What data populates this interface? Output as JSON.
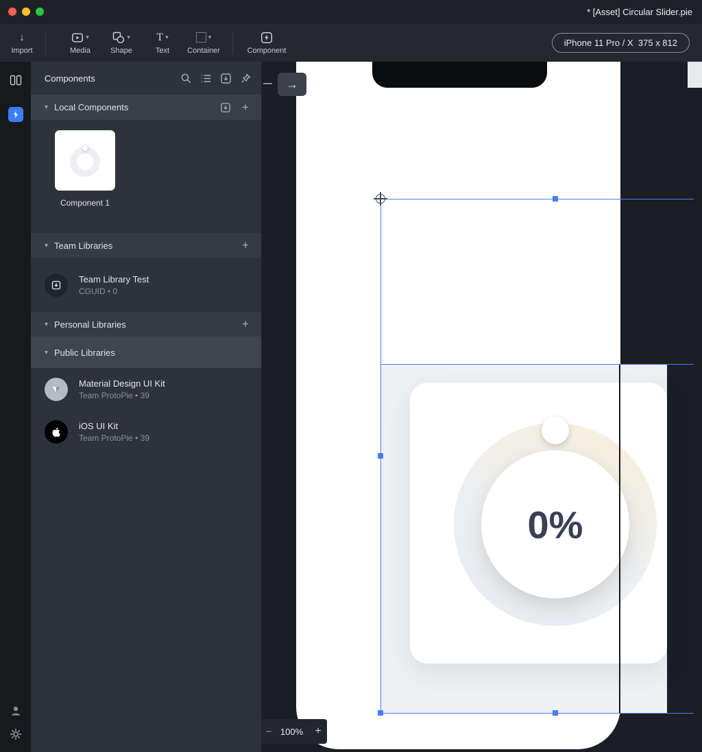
{
  "titlebar": {
    "title": "* [Asset] Circular Slider.pie"
  },
  "toolbar": {
    "import_label": "Import",
    "media_label": "Media",
    "shape_label": "Shape",
    "text_label": "Text",
    "container_label": "Container",
    "component_label": "Component",
    "device_label": "iPhone 11 Pro / X  375 x 812"
  },
  "sidebar": {
    "title": "Components",
    "local_section_label": "Local Components",
    "component_name": "Component 1",
    "team_section_label": "Team Libraries",
    "team_item": {
      "title": "Team Library Test",
      "subtitle": "CGUID • 0"
    },
    "personal_section_label": "Personal Libraries",
    "public_section_label": "Public Libraries",
    "libraries": [
      {
        "title": "Material Design UI Kit",
        "subtitle": "Team ProtoPie • 39"
      },
      {
        "title": "iOS UI Kit",
        "subtitle": "Team ProtoPie • 39"
      }
    ]
  },
  "canvas": {
    "slider_value": "0%",
    "zoom_value": "100%"
  },
  "glyphs": {
    "caret_down": "▾",
    "plus": "+",
    "minus": "−",
    "down_arrow": "↓",
    "forward_arrow": "→",
    "text_tool": "T"
  },
  "colors": {
    "selection_blue": "#4a7cf5",
    "accent_blue": "#3f7df6",
    "ring_tint": "#f6efdb"
  }
}
